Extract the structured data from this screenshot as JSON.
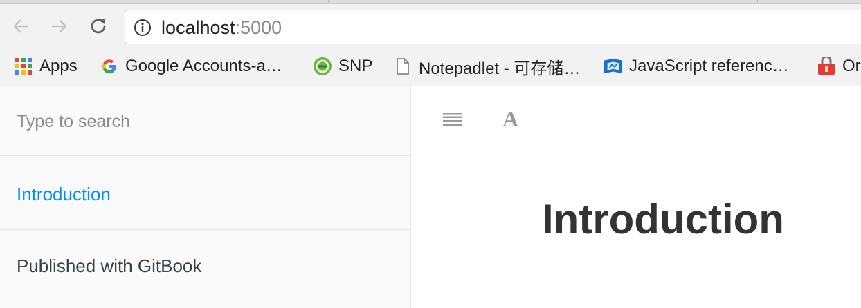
{
  "browser": {
    "url_host": "localhost",
    "url_port": ":5000",
    "bookmarks": [
      {
        "label": "Apps",
        "icon": "apps-grid-icon"
      },
      {
        "label": "Google Accounts-a…",
        "icon": "google-icon"
      },
      {
        "label": "SNP",
        "icon": "snp-icon"
      },
      {
        "label": "Notepadlet - 可存储…",
        "icon": "document-icon"
      },
      {
        "label": "JavaScript referenc…",
        "icon": "mdn-icon"
      },
      {
        "label": "Or",
        "icon": "bookmark-icon"
      }
    ]
  },
  "sidebar": {
    "search_placeholder": "Type to search",
    "items": [
      {
        "label": "Introduction",
        "active": true
      }
    ],
    "footer": "Published with GitBook"
  },
  "main": {
    "toolbar": {
      "menu_icon": "menu-icon",
      "font_settings_label": "A"
    },
    "page_title": "Introduction"
  },
  "colors": {
    "accent": "#008cff",
    "sidebar_bg": "#fafafa",
    "text": "#333333"
  }
}
